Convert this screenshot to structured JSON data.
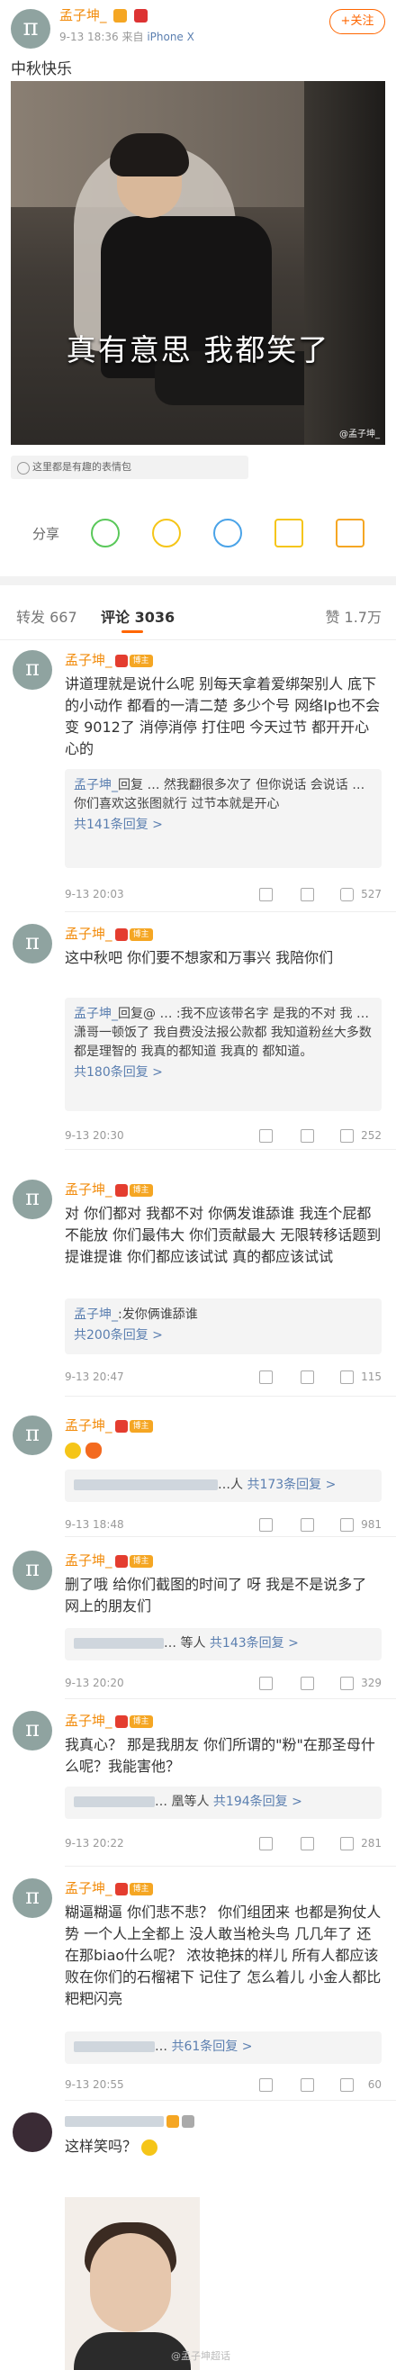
{
  "post": {
    "author": "孟子坤_",
    "date": "9-13 18:36",
    "source_prefix": "来自",
    "source": "iPhone X",
    "follow": "+关注",
    "text": "中秋快乐",
    "image_caption": "真有意思 我都笑了",
    "image_watermark": "@孟子坤_",
    "sticker_bar": "这里都是有趣的表情包"
  },
  "share": {
    "label": "分享"
  },
  "tabs": {
    "repost": "转发 667",
    "comments": "评论 3036",
    "likes": "赞 1.7万"
  },
  "comments": [
    {
      "name": "孟子坤_",
      "vip": "博主",
      "text": "讲道理就是说什么呢 别每天拿着爱绑架别人 底下的小动作 都看的一清二楚 多少个号 网络Ip也不会变 9012了 消停消停 打住吧 今天过节 都开开心心的",
      "reply_name": "孟子坤_",
      "reply_text": "回复 … 然我翻很多次了 但你说话 会说话 … 你们喜欢这张图就行 过节本就是开心",
      "reply_more": "共141条回复 >",
      "time": "9-13 20:03",
      "likes": "527"
    },
    {
      "name": "孟子坤_",
      "vip": "博主",
      "text": "这中秋吧 你们要不想家和万事兴 我陪你们",
      "reply_name": "孟子坤_",
      "reply_text": "回复@ … :我不应该带名字 是我的不对 我 … 潇哥一顿饭了 我自费没法报公款都 我知道粉丝大多数都是理智的 我真的都知道 我真的 都知道。",
      "reply_more": "共180条回复 >",
      "time": "9-13 20:30",
      "likes": "252"
    },
    {
      "name": "孟子坤_",
      "vip": "博主",
      "text": "对 你们都对 我都不对 你俩发谁舔谁 我连个屁都不能放 你们最伟大 你们贡献最大 无限转移话题到提谁提谁 你们都应该试试 真的都应该试试",
      "reply_name": "孟子坤_",
      "reply_text": ":发你俩谁舔谁",
      "reply_more": "共200条回复 >",
      "time": "9-13 20:47",
      "likes": "115"
    },
    {
      "name": "孟子坤_",
      "vip": "博主",
      "text": "",
      "reply_name": "",
      "reply_text": "…人",
      "reply_more": "共173条回复 >",
      "time": "9-13 18:48",
      "likes": "981"
    },
    {
      "name": "孟子坤_",
      "vip": "博主",
      "text": "删了哦 给你们截图的时间了 呀 我是不是说多了 网上的朋友们",
      "reply_name": "",
      "reply_text": "… 等人",
      "reply_more": "共143条回复 >",
      "time": "9-13 20:20",
      "likes": "329"
    },
    {
      "name": "孟子坤_",
      "vip": "博主",
      "text": "我真心？ 那是我朋友 你们所谓的\"粉\"在那圣母什么呢？我能害他？",
      "reply_name": "",
      "reply_text": "… 凰等人",
      "reply_more": "共194条回复 >",
      "time": "9-13 20:22",
      "likes": "281"
    },
    {
      "name": "孟子坤_",
      "vip": "博主",
      "text": "糊逼糊逼 你们悲不悲？ 你们组团来 也都是狗仗人势 一个人上全都上 没人敢当枪头鸟 几几年了 还在那biao什么呢？ 浓妆艳抹的样儿 所有人都应该败在你们的石榴裙下 记住了 怎么着儿 小金人都比粑粑闪亮",
      "reply_name": "",
      "reply_text": "…",
      "reply_more": "共61条回复 >",
      "time": "9-13 20:55",
      "likes": "60"
    },
    {
      "name": "",
      "text": "这样笑吗？",
      "bottom_watermark": "@孟子坤超话"
    }
  ]
}
